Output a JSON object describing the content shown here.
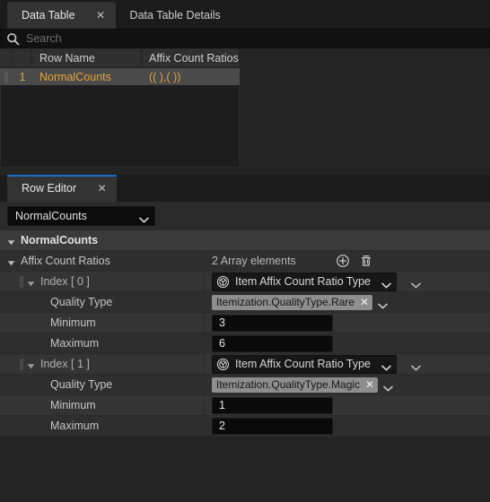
{
  "window": {
    "accent_blue": "#1a6cc4",
    "row_highlight": "#4a4a4a",
    "row_text_color": "#e8a33d"
  },
  "top_tabs": [
    {
      "label": "Data Table",
      "close_label": "✕",
      "active": true
    },
    {
      "label": "Data Table Details",
      "active": false
    }
  ],
  "search": {
    "placeholder": "Search",
    "icon": "search-icon"
  },
  "data_table": {
    "columns": [
      "Row Name",
      "Affix Count Ratios"
    ],
    "rows": [
      {
        "index": "1",
        "row_name": "NormalCounts",
        "affix_count_ratios": "(( ),( ))"
      }
    ]
  },
  "row_editor": {
    "tab_label": "Row Editor",
    "tab_close_label": "✕",
    "selected_row": "NormalCounts",
    "struct_header": "NormalCounts",
    "array_property": {
      "label": "Affix Count Ratios",
      "element_count_label": "2 Array elements",
      "add_icon": "plus-circle-icon",
      "delete_icon": "trash-icon"
    },
    "elements": [
      {
        "index_label": "Index [ 0 ]",
        "struct_type": "Item Affix Count Ratio Type",
        "struct_icon": "struct-globe-icon",
        "fields": [
          {
            "label": "Quality Type",
            "type": "tag",
            "value": "Itemization.QualityType.Rare",
            "clear_label": "✕"
          },
          {
            "label": "Minimum",
            "type": "number",
            "value": "3"
          },
          {
            "label": "Maximum",
            "type": "number",
            "value": "6"
          }
        ]
      },
      {
        "index_label": "Index [ 1 ]",
        "struct_type": "Item Affix Count Ratio Type",
        "struct_icon": "struct-globe-icon",
        "fields": [
          {
            "label": "Quality Type",
            "type": "tag",
            "value": "Itemization.QualityType.Magic",
            "clear_label": "✕"
          },
          {
            "label": "Minimum",
            "type": "number",
            "value": "1"
          },
          {
            "label": "Maximum",
            "type": "number",
            "value": "2"
          }
        ]
      }
    ]
  }
}
